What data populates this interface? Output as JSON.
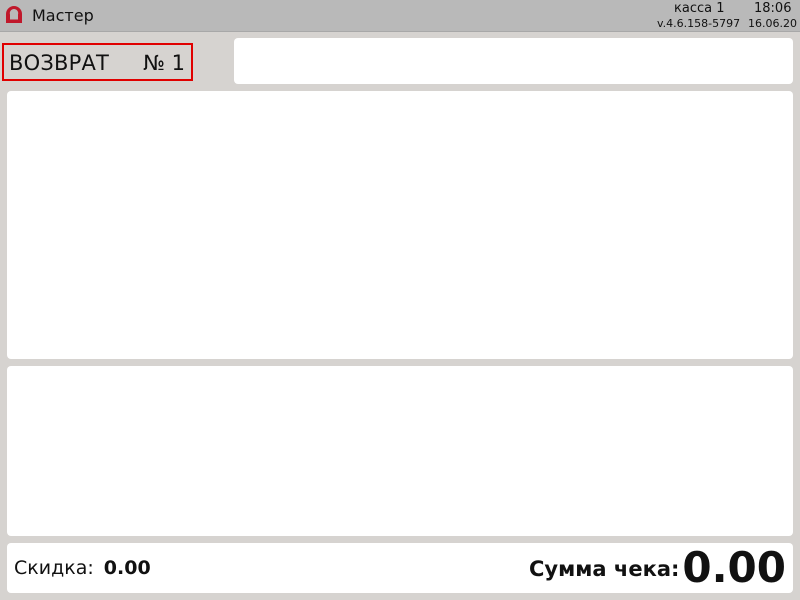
{
  "header": {
    "logo_icon": "app-logo-icon",
    "title": "Мастер",
    "register": "касса 1",
    "time": "18:06",
    "version": "v.4.6.158-5797",
    "date": "16.06.20"
  },
  "receipt": {
    "mode": "ВОЗВРАТ",
    "number": "№ 1",
    "highlight_color": "#e00000"
  },
  "footer": {
    "discount_label": "Скидка:",
    "discount_value": "0.00",
    "total_label": "Сумма чека:",
    "total_value": "0.00"
  },
  "colors": {
    "background": "#d6d3d0",
    "topbar": "#b9b9b9",
    "logo": "#c0182b"
  }
}
